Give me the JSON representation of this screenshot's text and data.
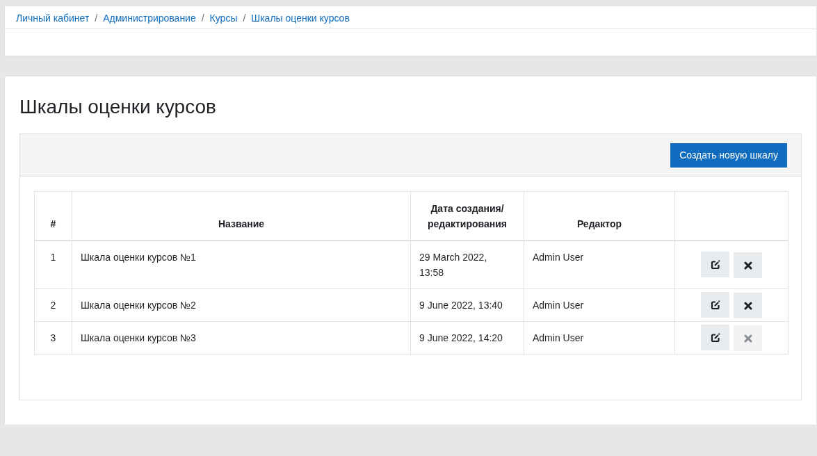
{
  "breadcrumb": [
    {
      "label": "Личный кабинет"
    },
    {
      "separator": "/",
      "label": "Администрирование"
    },
    {
      "separator": "/",
      "label": "Курсы"
    },
    {
      "separator": "/",
      "label": "Шкалы оценки курсов"
    }
  ],
  "page_title": "Шкалы оценки курсов",
  "create_button": "Создать новую шкалу",
  "table": {
    "columns": [
      "#",
      "Название",
      "Дата создания/ редактирования",
      "Редактор"
    ],
    "rows": [
      {
        "number": "1",
        "name": "Шкала оценки курсов №1",
        "date": "29 March 2022, 13:58",
        "editor": "Admin User",
        "delete_disabled": false
      },
      {
        "number": "2",
        "name": "Шкала оценки курсов №2",
        "date": "9 June 2022, 13:40",
        "editor": "Admin User",
        "delete_disabled": false
      },
      {
        "number": "3",
        "name": "Шкала оценки курсов №3",
        "date": "9 June 2022, 14:20",
        "editor": "Admin User",
        "delete_disabled": true
      }
    ]
  }
}
